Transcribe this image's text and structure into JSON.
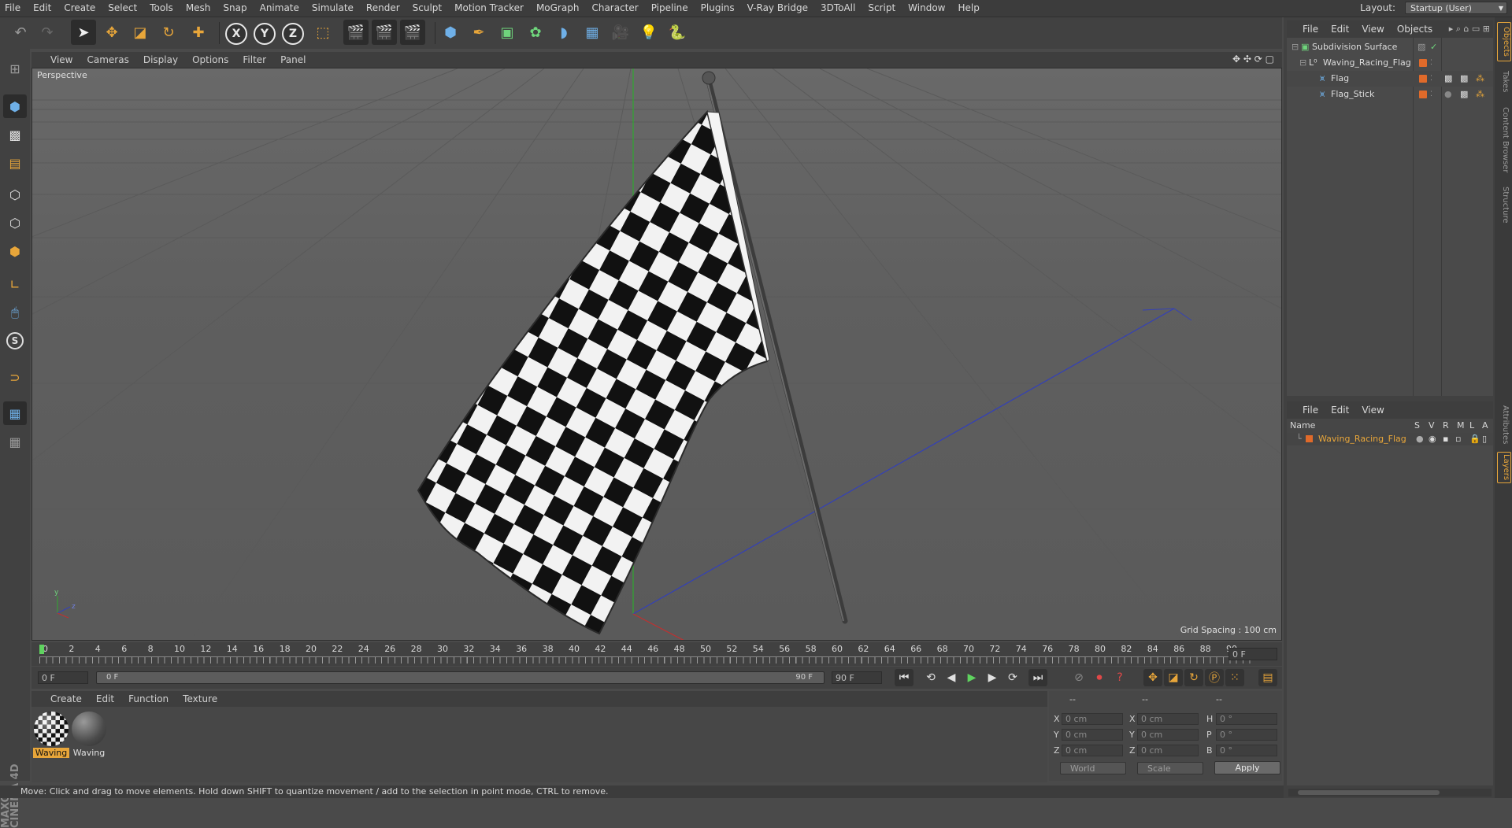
{
  "menubar": {
    "items": [
      "File",
      "Edit",
      "Create",
      "Select",
      "Tools",
      "Mesh",
      "Snap",
      "Animate",
      "Simulate",
      "Render",
      "Sculpt",
      "Motion Tracker",
      "MoGraph",
      "Character",
      "Pipeline",
      "Plugins",
      "V-Ray Bridge",
      "3DToAll",
      "Script",
      "Window",
      "Help"
    ],
    "layout_label": "Layout:",
    "layout_value": "Startup (User)"
  },
  "viewport": {
    "menu": [
      "View",
      "Cameras",
      "Display",
      "Options",
      "Filter",
      "Panel"
    ],
    "label": "Perspective",
    "grid_spacing": "Grid Spacing : 100 cm"
  },
  "timeline": {
    "ticks": [
      "0",
      "2",
      "4",
      "6",
      "8",
      "10",
      "12",
      "14",
      "16",
      "18",
      "20",
      "22",
      "24",
      "26",
      "28",
      "30",
      "32",
      "34",
      "36",
      "38",
      "40",
      "42",
      "44",
      "46",
      "48",
      "50",
      "52",
      "54",
      "56",
      "58",
      "60",
      "62",
      "64",
      "66",
      "68",
      "70",
      "72",
      "74",
      "76",
      "78",
      "80",
      "82",
      "84",
      "86",
      "88",
      "90"
    ],
    "current_frame_right": "0 F"
  },
  "transport": {
    "start_field": "0 F",
    "range_left": "0 F",
    "range_right": "90 F",
    "end_field": "90 F"
  },
  "materials": {
    "menu": [
      "Create",
      "Edit",
      "Function",
      "Texture"
    ],
    "items": [
      {
        "label": "Waving",
        "selected": true
      },
      {
        "label": "Waving",
        "selected": false
      }
    ]
  },
  "coords": {
    "header_a": "--",
    "header_b": "--",
    "header_c": "--",
    "rows": [
      {
        "l1": "X",
        "v1": "0 cm",
        "l2": "X",
        "v2": "0 cm",
        "l3": "H",
        "v3": "0 °"
      },
      {
        "l1": "Y",
        "v1": "0 cm",
        "l2": "Y",
        "v2": "0 cm",
        "l3": "P",
        "v3": "0 °"
      },
      {
        "l1": "Z",
        "v1": "0 cm",
        "l2": "Z",
        "v2": "0 cm",
        "l3": "B",
        "v3": "0 °"
      }
    ],
    "world": "World",
    "scale": "Scale",
    "apply": "Apply"
  },
  "status": "Move: Click and drag to move elements. Hold down SHIFT to quantize movement / add to the selection in point mode, CTRL to remove.",
  "objects": {
    "menu": [
      "File",
      "Edit",
      "View",
      "Objects"
    ],
    "items": [
      {
        "name": "Subdivision Surface"
      },
      {
        "name": "Waving_Racing_Flag"
      },
      {
        "name": "Flag"
      },
      {
        "name": "Flag_Stick"
      }
    ]
  },
  "layers": {
    "menu": [
      "File",
      "Edit",
      "View"
    ],
    "head_name": "Name",
    "head_cols": [
      "S",
      "V",
      "R",
      "M",
      "L",
      "A"
    ],
    "row_name": "Waving_Racing_Flag"
  },
  "side_tabs": [
    "Objects",
    "Takes",
    "Content Browser",
    "Structure",
    "Attributes",
    "Layers"
  ],
  "logo": "MAXON CINEMA 4D",
  "colors": {
    "accent": "#e8a63a",
    "tag": "#e06a2a"
  }
}
